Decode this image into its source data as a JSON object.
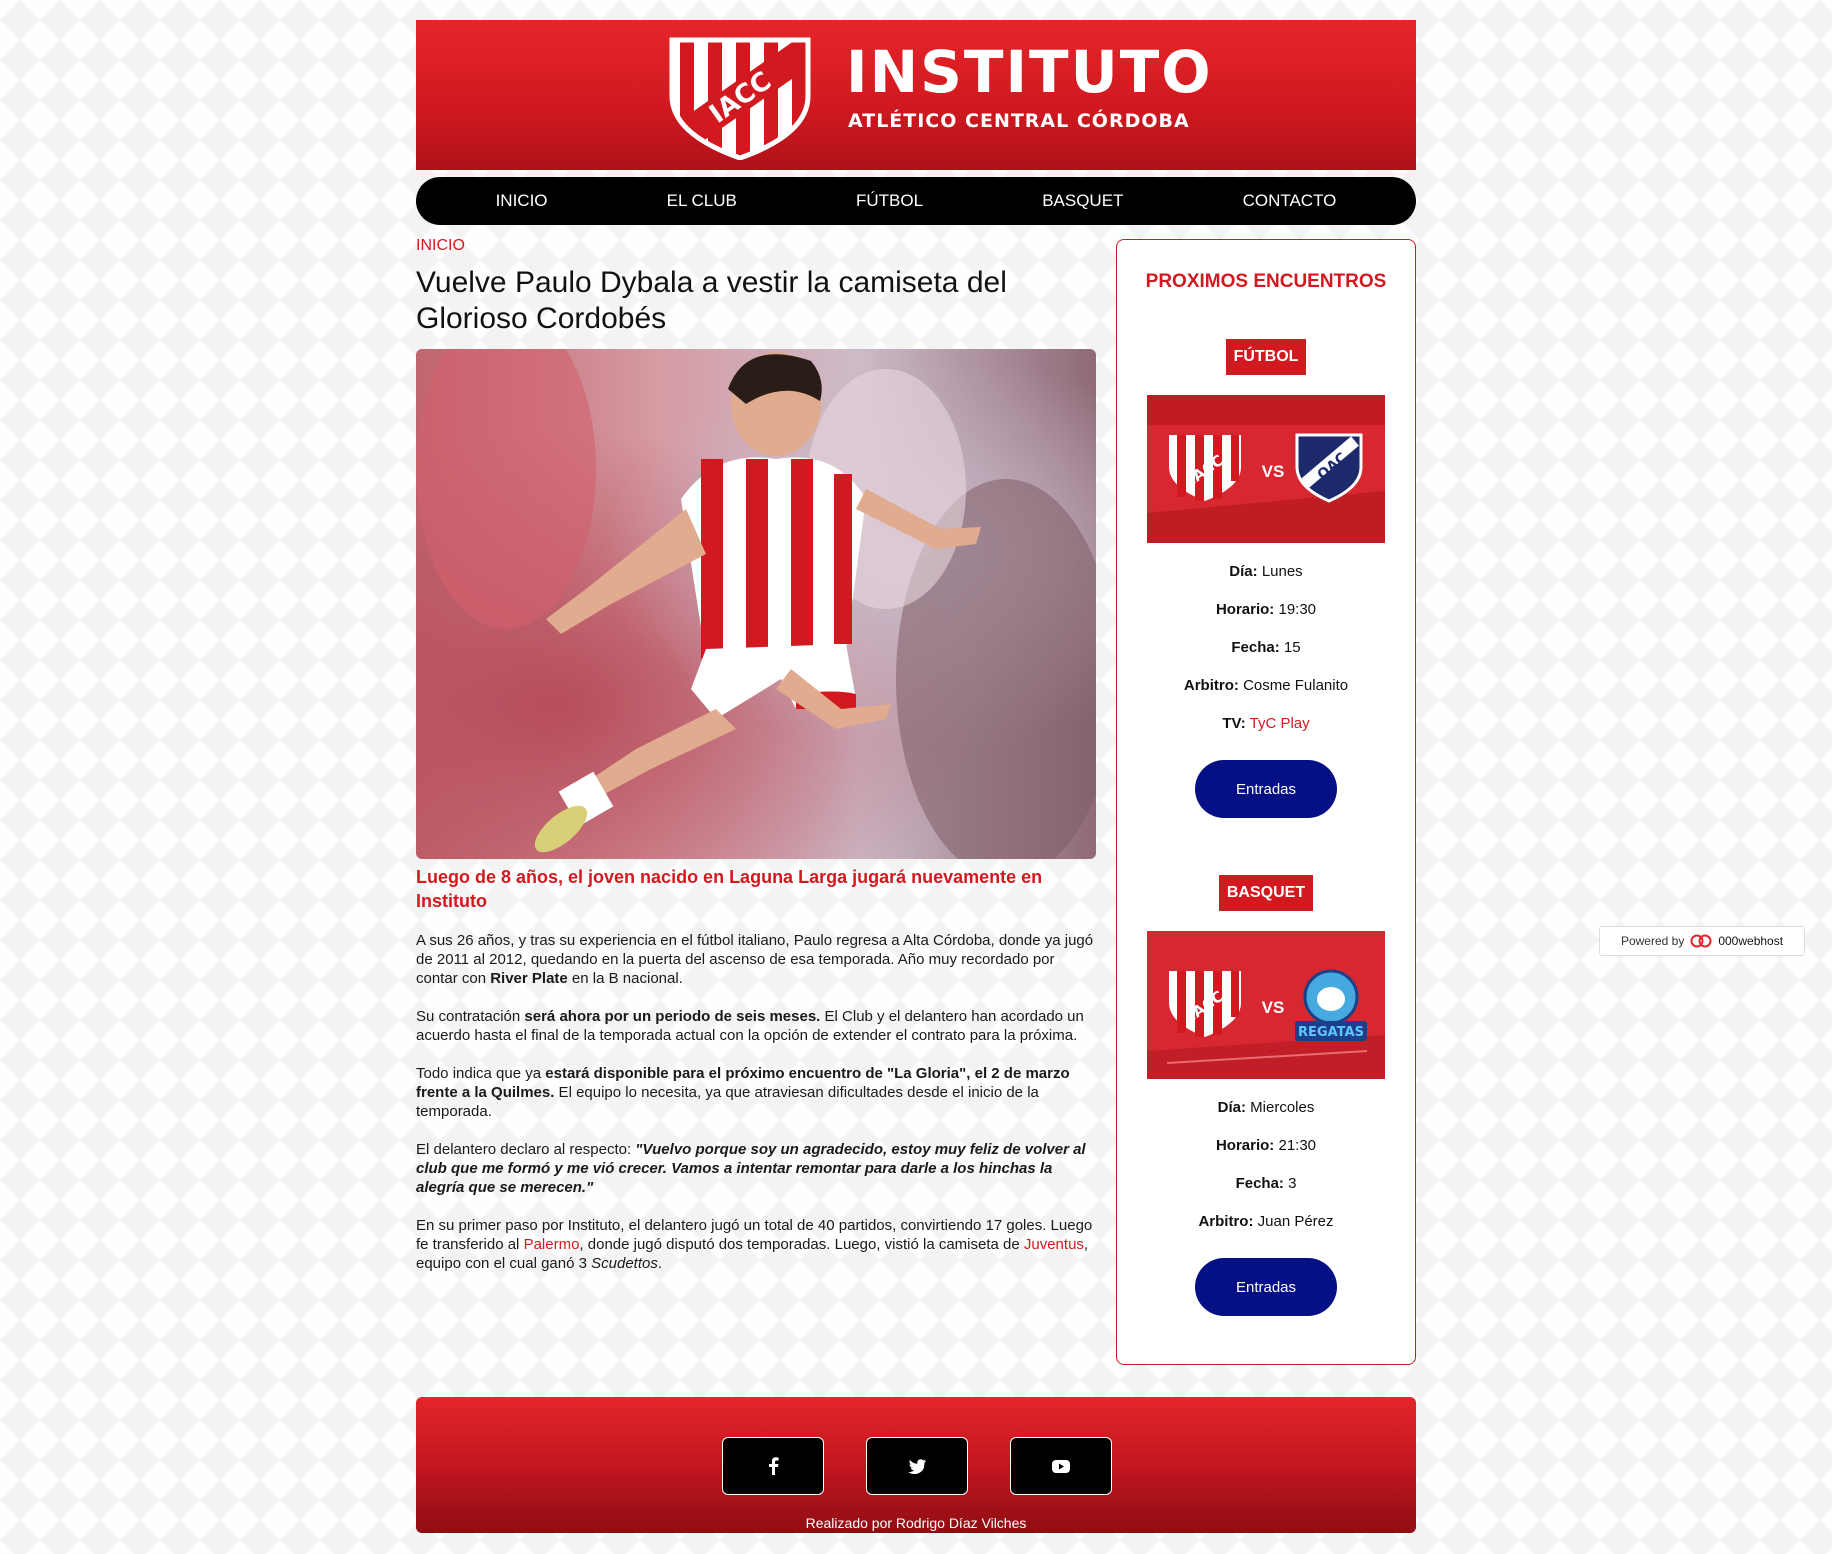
{
  "header": {
    "title": "INSTITUTO",
    "subtitle": "ATLÉTICO CENTRAL CÓRDOBA",
    "crest_text": "IACC"
  },
  "nav": {
    "items": [
      "INICIO",
      "EL CLUB",
      "FÚTBOL",
      "BASQUET",
      "CONTACTO"
    ]
  },
  "article": {
    "breadcrumb": "INICIO",
    "title": "Vuelve Paulo Dybala a vestir la camiseta del Glorioso Cordobés",
    "subtitle": "Luego de 8 años, el joven nacido en Laguna Larga jugará nuevamente en Instituto",
    "p1_a": "A sus 26 años, y tras su experiencia en el fútbol italiano, Paulo regresa a Alta Córdoba, donde ya jugó de 2011 al 2012, quedando en la puerta del ascenso de esa temporada. Año muy recordado por contar con ",
    "p1_b": "River Plate",
    "p1_c": " en la B nacional.",
    "p2_a": "Su contratación ",
    "p2_b": "será ahora por un periodo de seis meses.",
    "p2_c": " El Club y el delantero han acordado un acuerdo hasta el final de la temporada actual con la opción de extender el contrato para la próxima.",
    "p3_a": "Todo indica que ya ",
    "p3_b": "estará disponible para el próximo encuentro de \"La Gloria\", el 2 de marzo frente a la Quilmes.",
    "p3_c": " El equipo lo necesita, ya que atraviesan dificultades desde el inicio de la temporada.",
    "p4_a": "El delantero declaro al respecto: ",
    "p4_b": "\"Vuelvo porque soy un agradecido, estoy muy feliz de volver al club que me formó y me vió crecer. Vamos a intentar remontar para darle a los hinchas la alegría que se merecen.\"",
    "p5_a": "En su primer paso por Instituto, el delantero jugó un total de 40 partidos, convirtiendo 17 goles. Luego fe transferido al ",
    "p5_link1": "Palermo",
    "p5_b": ", donde jugó disputó dos temporadas. Luego, vistió la camiseta de ",
    "p5_link2": "Juventus",
    "p5_c": ", equipo con el cual ganó 3 ",
    "p5_d": "Scudettos",
    "p5_e": "."
  },
  "sidebar": {
    "title": "PROXIMOS ENCUENTROS",
    "football": {
      "badge": "FÚTBOL",
      "home": "IACC",
      "vs": "VS",
      "away": "QAC",
      "dia_label": "Día:",
      "dia": "Lunes",
      "horario_label": "Horario:",
      "horario": "19:30",
      "fecha_label": "Fecha:",
      "fecha": "15",
      "arbitro_label": "Arbitro:",
      "arbitro": "Cosme Fulanito",
      "tv_label": "TV:",
      "tv": "TyC Play",
      "button": "Entradas"
    },
    "basket": {
      "badge": "BASQUET",
      "home": "IACC",
      "vs": "VS",
      "away": "REGATAS",
      "dia_label": "Día:",
      "dia": "Miercoles",
      "horario_label": "Horario:",
      "horario": "21:30",
      "fecha_label": "Fecha:",
      "fecha": "3",
      "arbitro_label": "Arbitro:",
      "arbitro": "Juan Pérez",
      "button": "Entradas"
    }
  },
  "footer": {
    "social": [
      "facebook-icon",
      "twitter-icon",
      "youtube-icon"
    ],
    "credit": "Realizado por Rodrigo Díaz Vilches"
  },
  "powered": {
    "label": "Powered by",
    "brand": "000webhost"
  },
  "colors": {
    "brand_red": "#d31920",
    "ticket_blue": "#041083",
    "nav_black": "#000000"
  }
}
